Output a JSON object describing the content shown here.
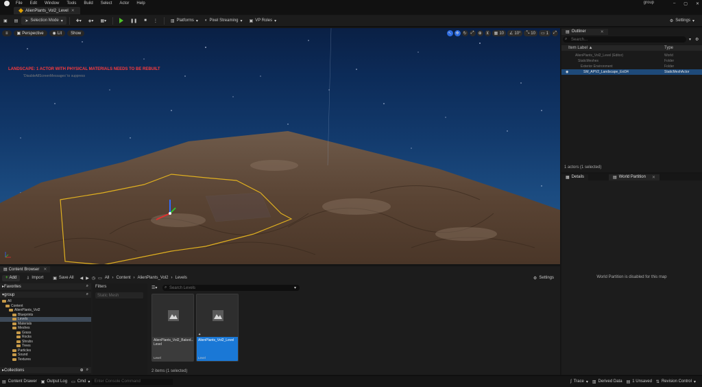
{
  "menubar": {
    "items": [
      "File",
      "Edit",
      "Window",
      "Tools",
      "Build",
      "Select",
      "Actor",
      "Help"
    ],
    "user": "group"
  },
  "level_tab": "AlienPlants_Vol2_Level",
  "toolbar": {
    "selection_mode": "Selection Mode",
    "platforms": "Platforms",
    "pixel_streaming": "Pixel Streaming",
    "vp_roles": "VP Roles",
    "settings": "Settings"
  },
  "viewport": {
    "perspective": "Perspective",
    "lit": "Lit",
    "show": "Show",
    "warning": "LANDSCAPE: 1 ACTOR WITH PHYSICAL MATERIALS NEEDS TO BE REBUILT",
    "warning_sub": "'DisableAllScreenMessages' to suppress",
    "grid_snap": "10",
    "rot_snap": "10°",
    "scale_snap": "10",
    "camera_speed": "1"
  },
  "outliner": {
    "tab": "Outliner",
    "search_placeholder": "Search...",
    "col_label": "Item Label ▲",
    "col_type": "Type",
    "rows": [
      {
        "label": "AlienPlants_Vol2_Level (Editor)",
        "type": "World"
      },
      {
        "label": "StaticMeshes",
        "type": "Folder"
      },
      {
        "label": "Exterior Environment",
        "type": "Folder"
      },
      {
        "label": "SM_APV2_Landscape_Ext34",
        "type": "StaticMeshActor"
      }
    ],
    "count": "1 actors (1 selected)"
  },
  "details": {
    "tab_details": "Details",
    "tab_world_partition": "World Partition",
    "message": "World Partition is disabled for this map"
  },
  "content_browser": {
    "tab": "Content Browser",
    "add": "Add",
    "import": "Import",
    "save_all": "Save All",
    "breadcrumb": [
      "All",
      "Content",
      "AlienPlants_Vol2",
      "Levels"
    ],
    "settings": "Settings",
    "favorites": "Favorites",
    "root": "group",
    "filters": "Filters",
    "filter_placeholder": "Static Mesh",
    "search_placeholder": "Search Levels",
    "tree": [
      {
        "label": "All",
        "depth": 0
      },
      {
        "label": "Content",
        "depth": 1
      },
      {
        "label": "AlienPlants_Vol2",
        "depth": 2
      },
      {
        "label": "Blueprints",
        "depth": 3
      },
      {
        "label": "Levels",
        "depth": 3,
        "selected": true
      },
      {
        "label": "Materials",
        "depth": 3
      },
      {
        "label": "Meshes",
        "depth": 3
      },
      {
        "label": "Grass",
        "depth": 4
      },
      {
        "label": "Rocks",
        "depth": 4
      },
      {
        "label": "Shrubs",
        "depth": 4
      },
      {
        "label": "Trees",
        "depth": 4
      },
      {
        "label": "Particles",
        "depth": 3
      },
      {
        "label": "Sound",
        "depth": 3
      },
      {
        "label": "Textures",
        "depth": 3
      }
    ],
    "assets": [
      {
        "name": "AlienPlants_Vol2_Baked... Level",
        "type": "Level",
        "selected": false
      },
      {
        "name": "AlienPlants_Vol2_Level",
        "type": "Level",
        "selected": true
      }
    ],
    "items_count": "2 items (1 selected)",
    "collections": "Collections"
  },
  "statusbar": {
    "content_drawer": "Content Drawer",
    "output_log": "Output Log",
    "cmd": "Cmd",
    "console_placeholder": "Enter Console Command",
    "trace": "Trace",
    "derived_data": "Derived Data",
    "unsaved": "1 Unsaved",
    "revision_control": "Revision Control"
  }
}
